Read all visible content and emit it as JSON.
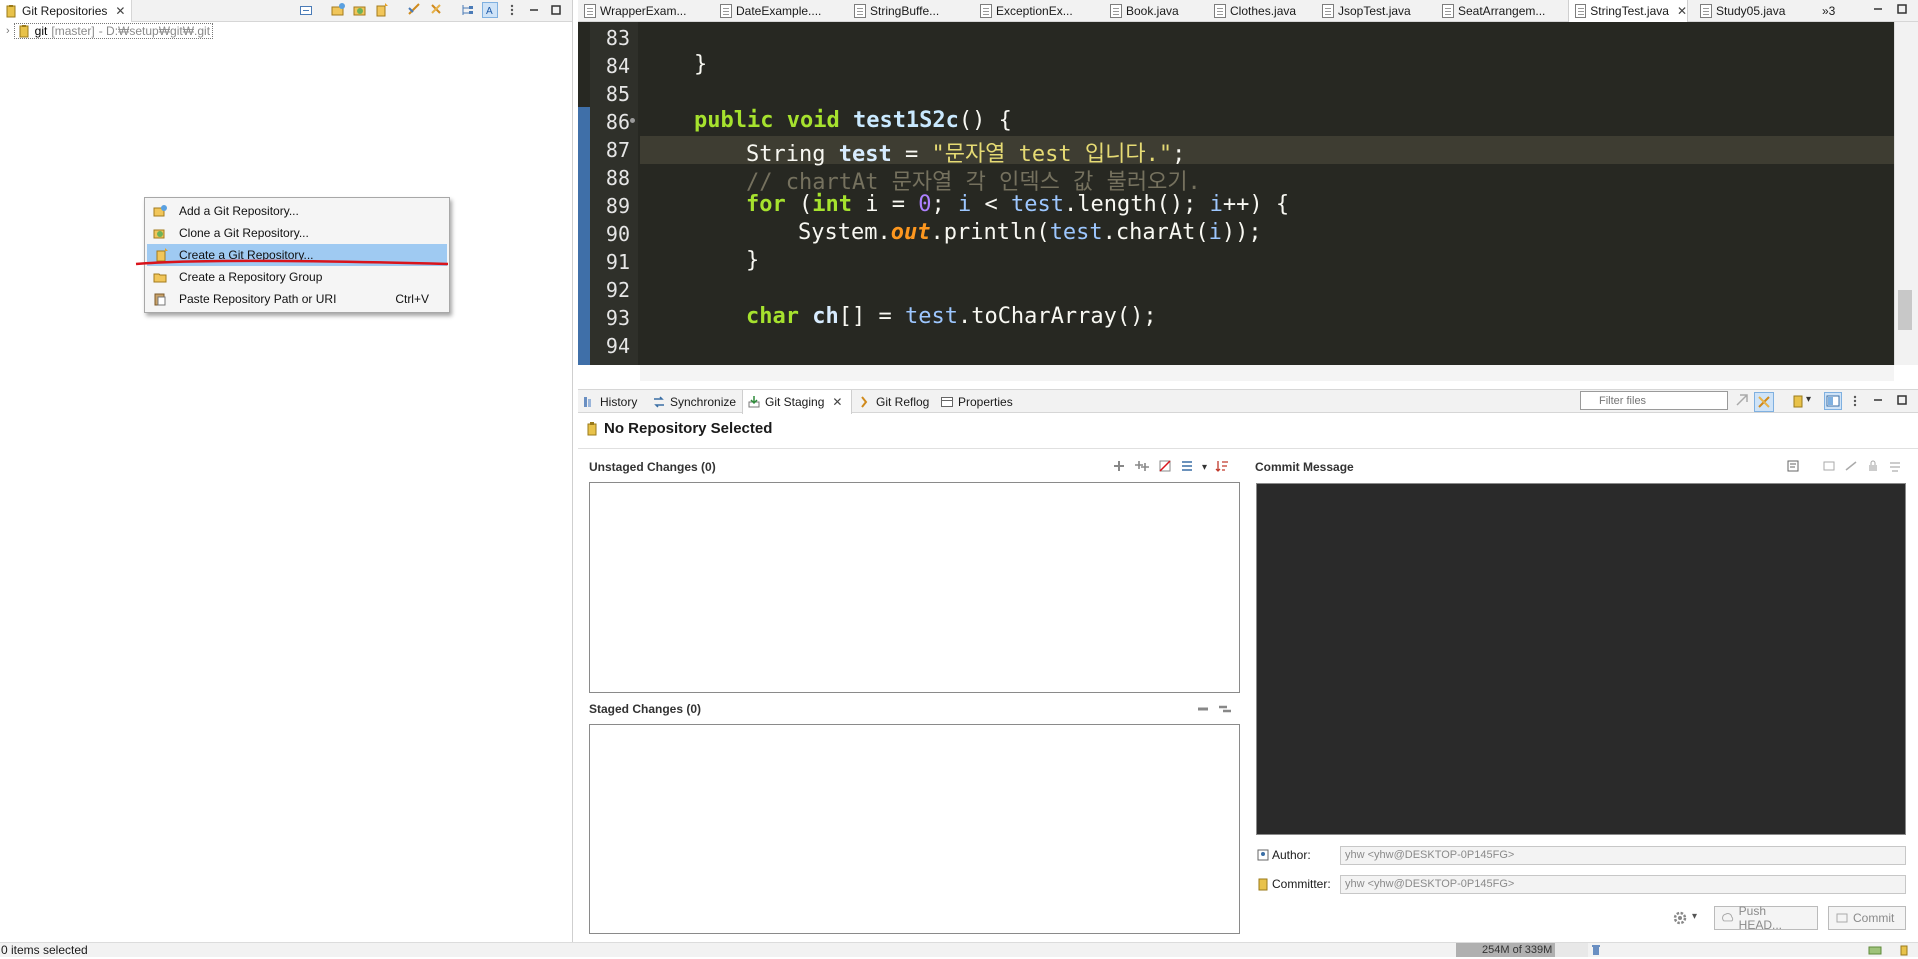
{
  "left_view": {
    "tab_title": "Git Repositories",
    "tree": {
      "name": "git",
      "branch": "[master]",
      "path": "- D:₩setup₩git₩.git"
    }
  },
  "context_menu": {
    "items": [
      {
        "label": "Add a Git Repository...",
        "icon": "add-repo-icon",
        "shortcut": ""
      },
      {
        "label": "Clone a Git Repository...",
        "icon": "clone-repo-icon",
        "shortcut": ""
      },
      {
        "label": "Create a Git Repository...",
        "icon": "create-repo-icon",
        "shortcut": "",
        "selected": true
      },
      {
        "label": "Create a Repository Group",
        "icon": "repo-group-icon",
        "shortcut": ""
      },
      {
        "label": "Paste Repository Path or URI",
        "icon": "paste-icon",
        "shortcut": "Ctrl+V"
      }
    ]
  },
  "editor": {
    "tabs": [
      {
        "label": "WrapperExam...",
        "active": false
      },
      {
        "label": "DateExample....",
        "active": false
      },
      {
        "label": "StringBuffe...",
        "active": false
      },
      {
        "label": "ExceptionEx...",
        "active": false
      },
      {
        "label": "Book.java",
        "active": false
      },
      {
        "label": "Clothes.java",
        "active": false
      },
      {
        "label": "JsopTest.java",
        "active": false
      },
      {
        "label": "SeatArrangem...",
        "active": false
      },
      {
        "label": "StringTest.java",
        "active": true
      },
      {
        "label": "Study05.java",
        "active": false
      }
    ],
    "overflow_label": "»3",
    "line_numbers": [
      "83",
      "84",
      "85",
      "86",
      "87",
      "88",
      "89",
      "90",
      "91",
      "92",
      "93",
      "94"
    ],
    "code": {
      "l84": "}",
      "l86_kw": "public void ",
      "l86_name": "test1S2c",
      "l86_rest": "() {",
      "l87_type": "String ",
      "l87_var": "test",
      "l87_eq": " = ",
      "l87_str": "\"문자열 test 입니다.\"",
      "l87_end": ";",
      "l88_comment": "// chartAt 문자열 각 인덱스 값 불러오기.",
      "l89_for": "for",
      "l89_a": " (",
      "l89_int": "int",
      "l89_b": " i = ",
      "l89_zero": "0",
      "l89_c": "; ",
      "l89_i1": "i",
      "l89_d": " < ",
      "l89_test": "test",
      "l89_e": ".length(); ",
      "l89_i2": "i",
      "l89_f": "++) {",
      "l90_a": "System.",
      "l90_out": "out",
      "l90_b": ".println(",
      "l90_test": "test",
      "l90_c": ".charAt(",
      "l90_i": "i",
      "l90_d": "));",
      "l91": "}",
      "l93_char": "char ",
      "l93_ch": "ch",
      "l93_a": "[] = ",
      "l93_test": "test",
      "l93_b": ".toCharArray();"
    }
  },
  "bottom_panel": {
    "tabs": [
      {
        "label": "History",
        "icon": "history-icon",
        "active": false
      },
      {
        "label": "Synchronize",
        "icon": "sync-icon",
        "active": false
      },
      {
        "label": "Git Staging",
        "icon": "staging-icon",
        "active": true
      },
      {
        "label": "Git Reflog",
        "icon": "reflog-icon",
        "active": false
      },
      {
        "label": "Properties",
        "icon": "properties-icon",
        "active": false
      }
    ],
    "filter_placeholder": "Filter files",
    "repo_status": "No Repository Selected",
    "unstaged_label": "Unstaged Changes (0)",
    "staged_label": "Staged Changes (0)",
    "commit_message_label": "Commit Message",
    "author_label": "Author:",
    "author_value": "yhw <yhw@DESKTOP-0P145FG>",
    "committer_label": "Committer:",
    "committer_value": "yhw <yhw@DESKTOP-0P145FG>",
    "push_button": "Push HEAD...",
    "commit_button": "Commit"
  },
  "status_bar": {
    "selection": "0 items selected",
    "heap": "254M of 339M",
    "heap_fraction": 0.75
  },
  "colors": {
    "editor_bg": "#272822",
    "menu_highlight": "#9fcaf2",
    "annotation_red": "#d9141c"
  }
}
